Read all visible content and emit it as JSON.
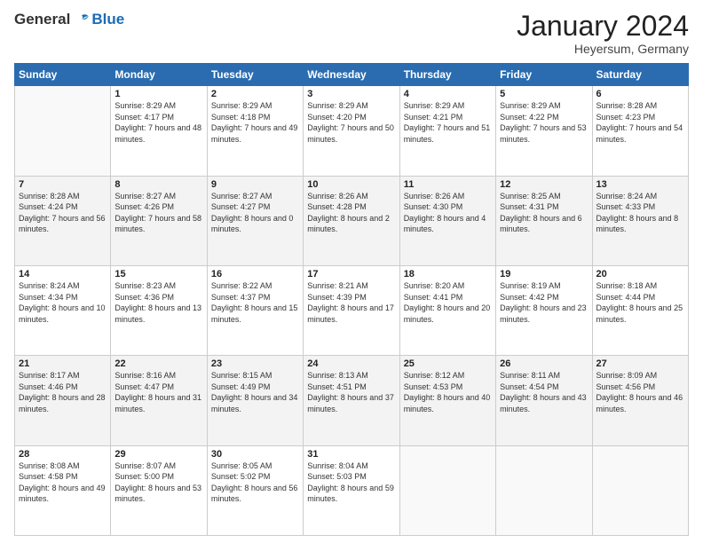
{
  "header": {
    "logo_general": "General",
    "logo_blue": "Blue",
    "month_title": "January 2024",
    "location": "Heyersum, Germany"
  },
  "days_of_week": [
    "Sunday",
    "Monday",
    "Tuesday",
    "Wednesday",
    "Thursday",
    "Friday",
    "Saturday"
  ],
  "weeks": [
    [
      {
        "day": "",
        "sunrise": "",
        "sunset": "",
        "daylight": "",
        "empty": true
      },
      {
        "day": "1",
        "sunrise": "Sunrise: 8:29 AM",
        "sunset": "Sunset: 4:17 PM",
        "daylight": "Daylight: 7 hours and 48 minutes."
      },
      {
        "day": "2",
        "sunrise": "Sunrise: 8:29 AM",
        "sunset": "Sunset: 4:18 PM",
        "daylight": "Daylight: 7 hours and 49 minutes."
      },
      {
        "day": "3",
        "sunrise": "Sunrise: 8:29 AM",
        "sunset": "Sunset: 4:20 PM",
        "daylight": "Daylight: 7 hours and 50 minutes."
      },
      {
        "day": "4",
        "sunrise": "Sunrise: 8:29 AM",
        "sunset": "Sunset: 4:21 PM",
        "daylight": "Daylight: 7 hours and 51 minutes."
      },
      {
        "day": "5",
        "sunrise": "Sunrise: 8:29 AM",
        "sunset": "Sunset: 4:22 PM",
        "daylight": "Daylight: 7 hours and 53 minutes."
      },
      {
        "day": "6",
        "sunrise": "Sunrise: 8:28 AM",
        "sunset": "Sunset: 4:23 PM",
        "daylight": "Daylight: 7 hours and 54 minutes."
      }
    ],
    [
      {
        "day": "7",
        "sunrise": "Sunrise: 8:28 AM",
        "sunset": "Sunset: 4:24 PM",
        "daylight": "Daylight: 7 hours and 56 minutes."
      },
      {
        "day": "8",
        "sunrise": "Sunrise: 8:27 AM",
        "sunset": "Sunset: 4:26 PM",
        "daylight": "Daylight: 7 hours and 58 minutes."
      },
      {
        "day": "9",
        "sunrise": "Sunrise: 8:27 AM",
        "sunset": "Sunset: 4:27 PM",
        "daylight": "Daylight: 8 hours and 0 minutes."
      },
      {
        "day": "10",
        "sunrise": "Sunrise: 8:26 AM",
        "sunset": "Sunset: 4:28 PM",
        "daylight": "Daylight: 8 hours and 2 minutes."
      },
      {
        "day": "11",
        "sunrise": "Sunrise: 8:26 AM",
        "sunset": "Sunset: 4:30 PM",
        "daylight": "Daylight: 8 hours and 4 minutes."
      },
      {
        "day": "12",
        "sunrise": "Sunrise: 8:25 AM",
        "sunset": "Sunset: 4:31 PM",
        "daylight": "Daylight: 8 hours and 6 minutes."
      },
      {
        "day": "13",
        "sunrise": "Sunrise: 8:24 AM",
        "sunset": "Sunset: 4:33 PM",
        "daylight": "Daylight: 8 hours and 8 minutes."
      }
    ],
    [
      {
        "day": "14",
        "sunrise": "Sunrise: 8:24 AM",
        "sunset": "Sunset: 4:34 PM",
        "daylight": "Daylight: 8 hours and 10 minutes."
      },
      {
        "day": "15",
        "sunrise": "Sunrise: 8:23 AM",
        "sunset": "Sunset: 4:36 PM",
        "daylight": "Daylight: 8 hours and 13 minutes."
      },
      {
        "day": "16",
        "sunrise": "Sunrise: 8:22 AM",
        "sunset": "Sunset: 4:37 PM",
        "daylight": "Daylight: 8 hours and 15 minutes."
      },
      {
        "day": "17",
        "sunrise": "Sunrise: 8:21 AM",
        "sunset": "Sunset: 4:39 PM",
        "daylight": "Daylight: 8 hours and 17 minutes."
      },
      {
        "day": "18",
        "sunrise": "Sunrise: 8:20 AM",
        "sunset": "Sunset: 4:41 PM",
        "daylight": "Daylight: 8 hours and 20 minutes."
      },
      {
        "day": "19",
        "sunrise": "Sunrise: 8:19 AM",
        "sunset": "Sunset: 4:42 PM",
        "daylight": "Daylight: 8 hours and 23 minutes."
      },
      {
        "day": "20",
        "sunrise": "Sunrise: 8:18 AM",
        "sunset": "Sunset: 4:44 PM",
        "daylight": "Daylight: 8 hours and 25 minutes."
      }
    ],
    [
      {
        "day": "21",
        "sunrise": "Sunrise: 8:17 AM",
        "sunset": "Sunset: 4:46 PM",
        "daylight": "Daylight: 8 hours and 28 minutes."
      },
      {
        "day": "22",
        "sunrise": "Sunrise: 8:16 AM",
        "sunset": "Sunset: 4:47 PM",
        "daylight": "Daylight: 8 hours and 31 minutes."
      },
      {
        "day": "23",
        "sunrise": "Sunrise: 8:15 AM",
        "sunset": "Sunset: 4:49 PM",
        "daylight": "Daylight: 8 hours and 34 minutes."
      },
      {
        "day": "24",
        "sunrise": "Sunrise: 8:13 AM",
        "sunset": "Sunset: 4:51 PM",
        "daylight": "Daylight: 8 hours and 37 minutes."
      },
      {
        "day": "25",
        "sunrise": "Sunrise: 8:12 AM",
        "sunset": "Sunset: 4:53 PM",
        "daylight": "Daylight: 8 hours and 40 minutes."
      },
      {
        "day": "26",
        "sunrise": "Sunrise: 8:11 AM",
        "sunset": "Sunset: 4:54 PM",
        "daylight": "Daylight: 8 hours and 43 minutes."
      },
      {
        "day": "27",
        "sunrise": "Sunrise: 8:09 AM",
        "sunset": "Sunset: 4:56 PM",
        "daylight": "Daylight: 8 hours and 46 minutes."
      }
    ],
    [
      {
        "day": "28",
        "sunrise": "Sunrise: 8:08 AM",
        "sunset": "Sunset: 4:58 PM",
        "daylight": "Daylight: 8 hours and 49 minutes."
      },
      {
        "day": "29",
        "sunrise": "Sunrise: 8:07 AM",
        "sunset": "Sunset: 5:00 PM",
        "daylight": "Daylight: 8 hours and 53 minutes."
      },
      {
        "day": "30",
        "sunrise": "Sunrise: 8:05 AM",
        "sunset": "Sunset: 5:02 PM",
        "daylight": "Daylight: 8 hours and 56 minutes."
      },
      {
        "day": "31",
        "sunrise": "Sunrise: 8:04 AM",
        "sunset": "Sunset: 5:03 PM",
        "daylight": "Daylight: 8 hours and 59 minutes."
      },
      {
        "day": "",
        "empty": true
      },
      {
        "day": "",
        "empty": true
      },
      {
        "day": "",
        "empty": true
      }
    ]
  ]
}
